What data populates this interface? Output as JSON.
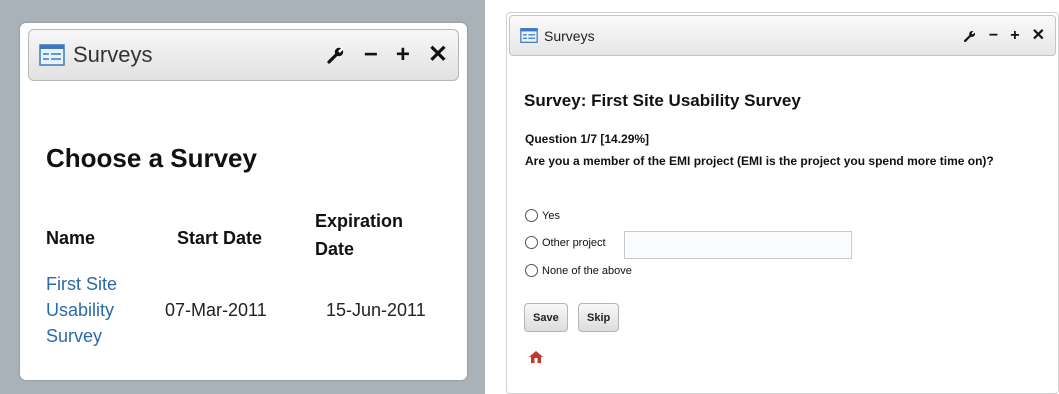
{
  "left": {
    "window_title": "Surveys",
    "heading": "Choose a Survey",
    "table": {
      "headers": {
        "name": "Name",
        "start": "Start Date",
        "expiration_line1": "Expiration",
        "expiration_line2": "Date"
      },
      "rows": [
        {
          "name_lines": [
            "First Site",
            "Usability",
            "Survey"
          ],
          "start_date": "07-Mar-2011",
          "expiration_date": "15-Jun-2011"
        }
      ]
    },
    "controls": {
      "wrench": "✪",
      "minimize": "−",
      "maximize": "+",
      "close": "✕"
    }
  },
  "right": {
    "window_title": "Surveys",
    "survey_title": "Survey: First Site Usability Survey",
    "question_progress": "Question 1/7 [14.29%]",
    "question_text": "Are you a member of the EMI project (EMI is the project you spend more time on)?",
    "options": [
      "Yes",
      "Other project",
      "None of the above"
    ],
    "other_input_value": "",
    "buttons": {
      "save": "Save",
      "skip": "Skip"
    }
  },
  "colors": {
    "link": "#2a6aa8",
    "left_background": "#a9b2b9",
    "home_icon": "#c0392b"
  },
  "icons": {
    "window": "window-list-icon",
    "settings": "wrench-icon",
    "minimize": "minimize-icon",
    "maximize": "maximize-icon",
    "close": "close-icon",
    "home": "home-icon"
  }
}
